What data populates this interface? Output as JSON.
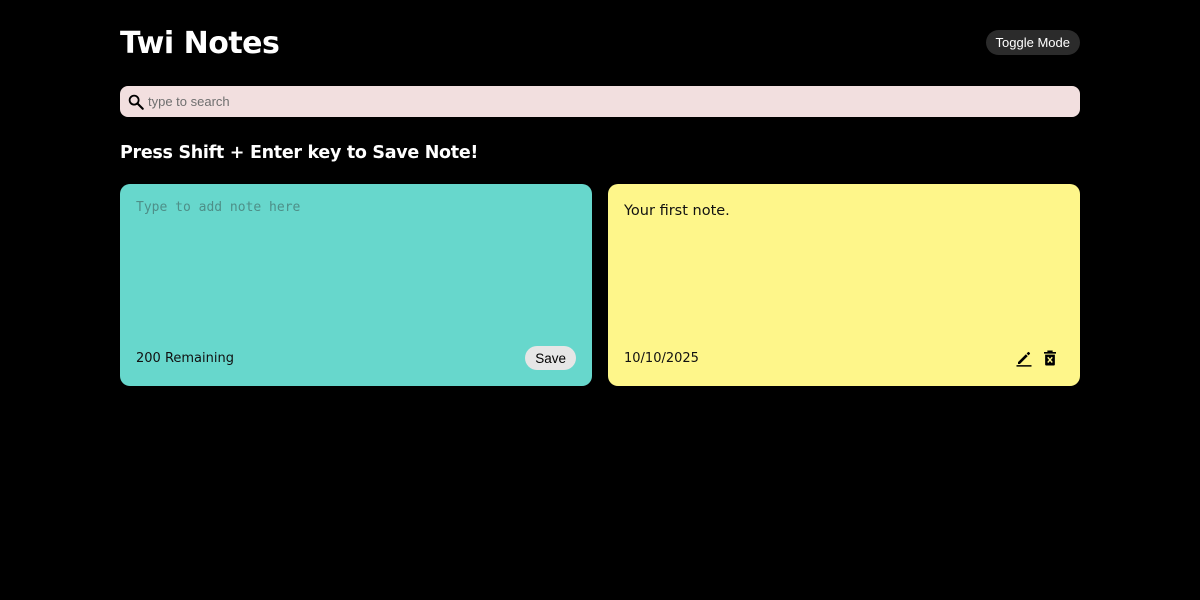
{
  "header": {
    "title": "Twi Notes",
    "toggle_label": "Toggle Mode"
  },
  "search": {
    "placeholder": "type to search",
    "icon": "search-icon"
  },
  "hint": "Press Shift + Enter key to Save Note!",
  "new_note": {
    "placeholder": "Type to add note here",
    "remaining": "200 Remaining",
    "save_label": "Save",
    "color": "#67d7cc"
  },
  "notes": [
    {
      "text": "Your first note.",
      "date": "10/10/2025",
      "color": "#fef68a",
      "icons": [
        "edit-icon",
        "delete-icon"
      ]
    }
  ],
  "colors": {
    "background": "#000000",
    "search_bg": "#f2dfdf",
    "toggle_bg": "#2b2b2b"
  }
}
